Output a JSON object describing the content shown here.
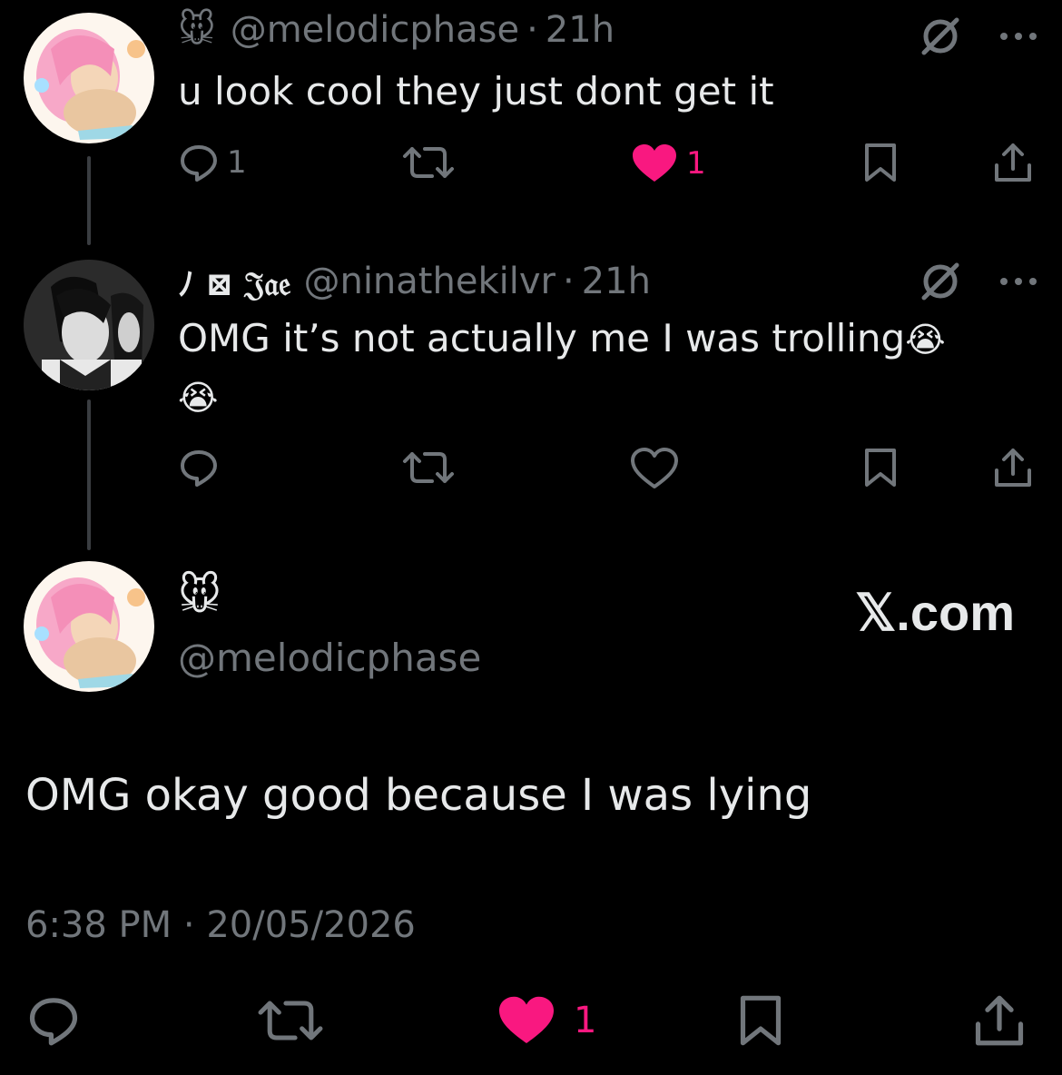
{
  "tweets": [
    {
      "emoji": "🐭",
      "display_name": "",
      "handle": "@melodicphase",
      "time": "21h",
      "text": "u look cool they just dont get it",
      "actions": {
        "reply_count": "1",
        "retweet_count": "",
        "like_count": "1",
        "liked": true
      }
    },
    {
      "emoji": "",
      "display_name": "ﾉ ⊠ 𝔍𝔞𝔢",
      "handle": "@ninathekilvr",
      "time": "21h",
      "text": "OMG it’s not actually me I was trolling",
      "trailing_emoji": "😭",
      "second_line_emoji": "😭",
      "actions": {
        "reply_count": "",
        "retweet_count": "",
        "like_count": "",
        "liked": false
      }
    }
  ],
  "main_tweet": {
    "name_emoji": "🐭",
    "handle": "@melodicphase",
    "brand": "𝕏.com",
    "text": "OMG okay good because I was lying",
    "timestamp": "6:38 PM · 20/05/2026",
    "actions": {
      "like_count": "1",
      "liked": true
    }
  },
  "icons": {
    "reply": "reply-icon",
    "retweet": "retweet-icon",
    "like": "heart-icon",
    "bookmark": "bookmark-icon",
    "share": "share-icon",
    "grok": "grok-icon",
    "more": "more-icon"
  },
  "colors": {
    "background": "#000000",
    "text": "#e7e9ea",
    "muted": "#71767b",
    "like": "#f91880"
  }
}
